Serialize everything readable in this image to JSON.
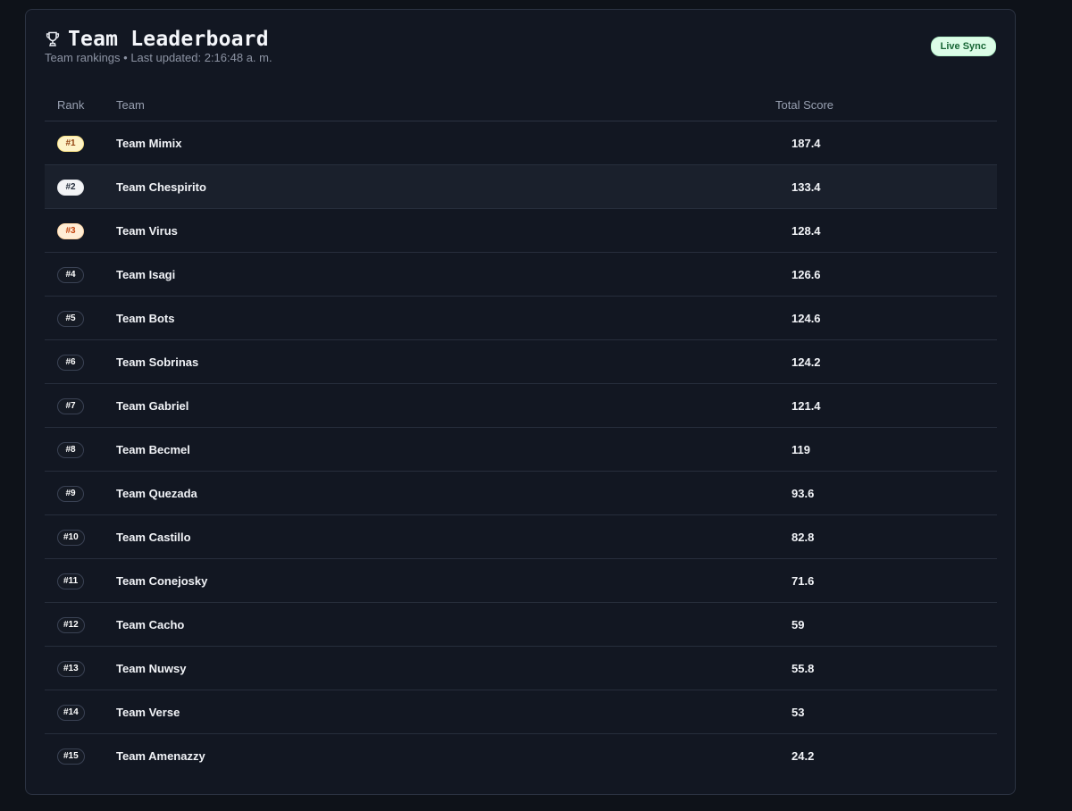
{
  "header": {
    "title": "Team Leaderboard",
    "subtitle": "Team rankings • Last updated: 2:16:48 a. m.",
    "live_badge": "Live Sync",
    "icon": "trophy-icon"
  },
  "table": {
    "columns": {
      "rank": "Rank",
      "team": "Team",
      "score": "Total Score"
    },
    "rows": [
      {
        "rank": "#1",
        "team": "Team Mimix",
        "score": "187.4"
      },
      {
        "rank": "#2",
        "team": "Team Chespirito",
        "score": "133.4"
      },
      {
        "rank": "#3",
        "team": "Team Virus",
        "score": "128.4"
      },
      {
        "rank": "#4",
        "team": "Team Isagi",
        "score": "126.6"
      },
      {
        "rank": "#5",
        "team": "Team Bots",
        "score": "124.6"
      },
      {
        "rank": "#6",
        "team": "Team Sobrinas",
        "score": "124.2"
      },
      {
        "rank": "#7",
        "team": "Team Gabriel",
        "score": "121.4"
      },
      {
        "rank": "#8",
        "team": "Team Becmel",
        "score": "119"
      },
      {
        "rank": "#9",
        "team": "Team Quezada",
        "score": "93.6"
      },
      {
        "rank": "#10",
        "team": "Team Castillo",
        "score": "82.8"
      },
      {
        "rank": "#11",
        "team": "Team Conejosky",
        "score": "71.6"
      },
      {
        "rank": "#12",
        "team": "Team Cacho",
        "score": "59"
      },
      {
        "rank": "#13",
        "team": "Team Nuwsy",
        "score": "55.8"
      },
      {
        "rank": "#14",
        "team": "Team Verse",
        "score": "53"
      },
      {
        "rank": "#15",
        "team": "Team Amenazzy",
        "score": "24.2"
      }
    ]
  },
  "colors": {
    "background": "#0e1219",
    "card": "#121722",
    "gold": "#fef3c7",
    "silver": "#f3f4f6",
    "bronze": "#ffedd5",
    "live": "#dcfce7"
  }
}
